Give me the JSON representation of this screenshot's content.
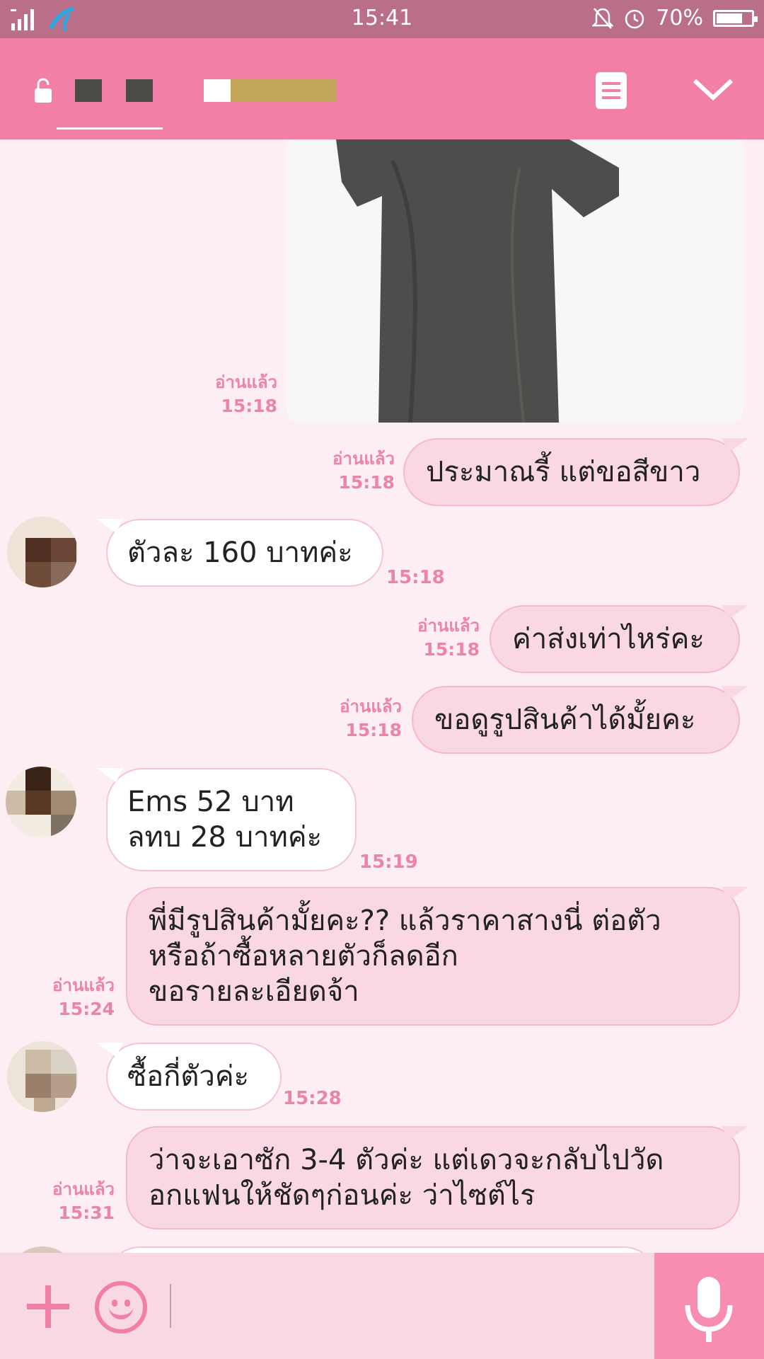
{
  "status_bar": {
    "time": "15:41",
    "battery": "70%",
    "icons": [
      "signal-icon",
      "app-notification-icon",
      "bell-off-icon",
      "alarm-icon",
      "battery-icon"
    ]
  },
  "header": {
    "icons": [
      "lock-icon",
      "memo-icon",
      "chevron-down-icon"
    ]
  },
  "messages": [
    {
      "dir": "out",
      "type": "image",
      "read": "อ่านแล้ว",
      "time": "15:18"
    },
    {
      "dir": "out",
      "text": "ประมาณรี้ แต่ขอสีขาว",
      "read": "อ่านแล้ว",
      "time": "15:18"
    },
    {
      "dir": "in",
      "text": "ตัวละ 160 บาทค่ะ",
      "time": "15:18"
    },
    {
      "dir": "out",
      "text": "ค่าส่งเท่าไหร่คะ",
      "read": "อ่านแล้ว",
      "time": "15:18"
    },
    {
      "dir": "out",
      "text": "ขอดูรูปสินค้าได้มั้ยคะ",
      "read": "อ่านแล้ว",
      "time": "15:18"
    },
    {
      "dir": "in",
      "lines": [
        "Ems 52 บาท",
        "ลทบ 28 บาทค่ะ"
      ],
      "time": "15:19"
    },
    {
      "dir": "out",
      "lines": [
        "พี่มีรูปสินค้ามั้ยคะ?? แล้วราคาสางนี่ ต่อตัว",
        "หรือถ้าซื้อหลายตัวก็ลดอีก",
        "ขอรายละเอียดจ้า"
      ],
      "read": "อ่านแล้ว",
      "time": "15:24"
    },
    {
      "dir": "in",
      "text": "ซื้อกี่ตัวค่ะ",
      "time": "15:28"
    },
    {
      "dir": "out",
      "lines": [
        "ว่าจะเอาซัก 3-4 ตัวค่ะ แต่เดวจะกลับไปวัด",
        "อกแฟนให้ชัดๆก่อนค่ะ ว่าไซต์ไร"
      ],
      "read": "อ่านแล้ว",
      "time": "15:31"
    }
  ],
  "input_bar": {
    "icons": [
      "plus-icon",
      "emoji-icon",
      "microphone-icon"
    ],
    "text_value": ""
  },
  "colors": {
    "header": "#f17fa8",
    "status_bar": "#b96e8a",
    "outgoing_bubble": "#f9d7e3",
    "read_label": "#ea84a8"
  }
}
